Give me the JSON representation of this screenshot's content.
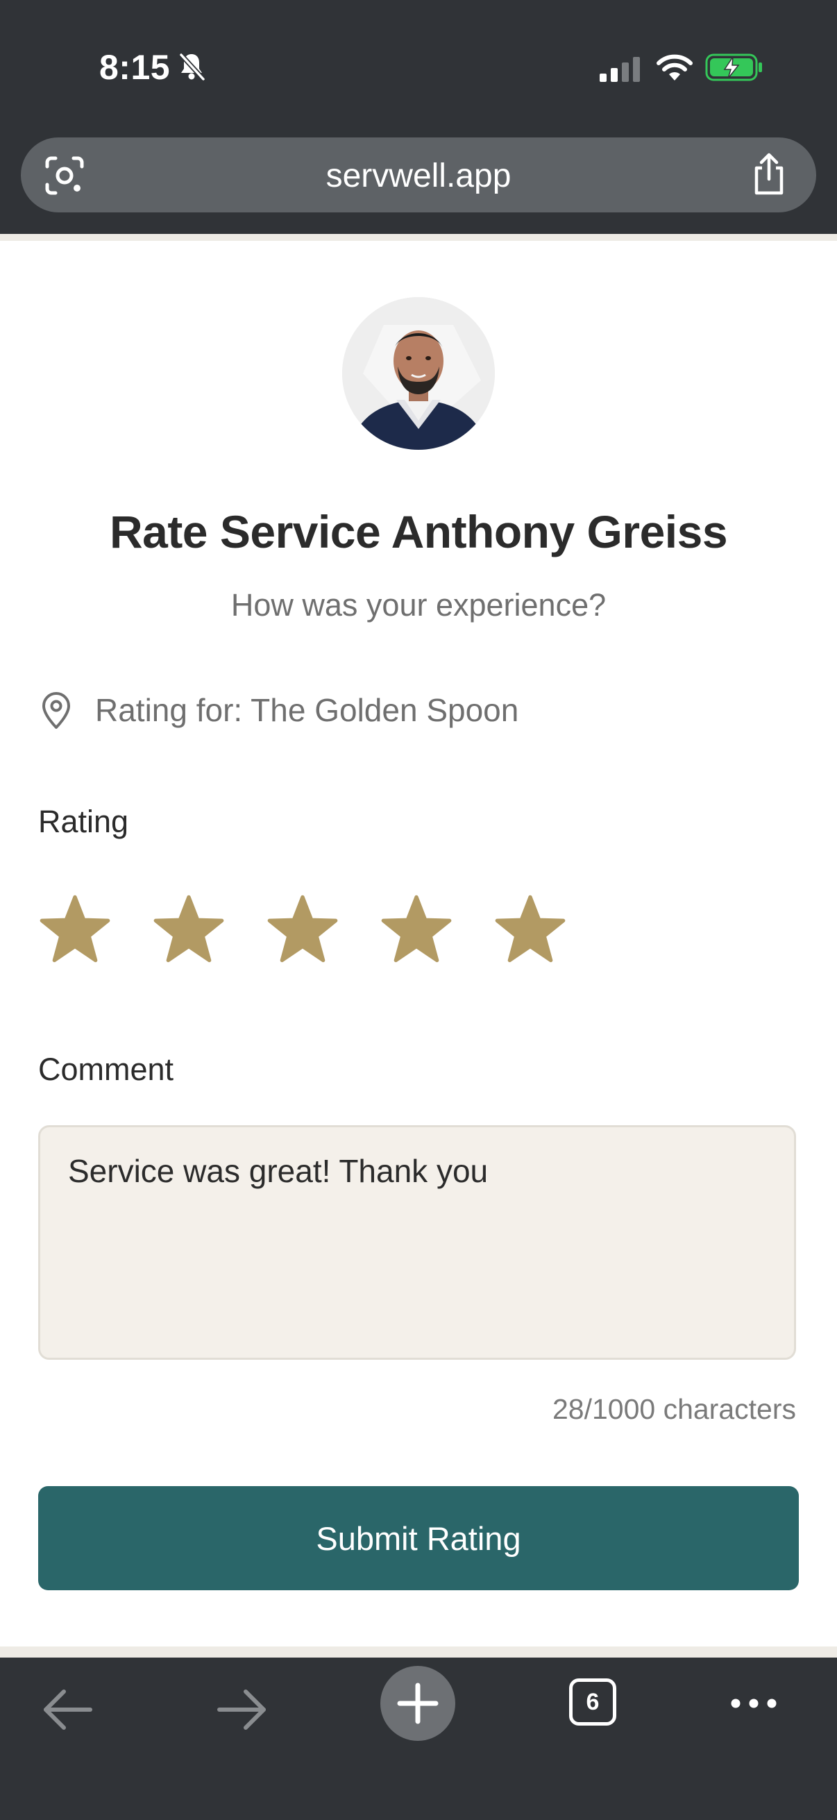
{
  "status_bar": {
    "time": "8:15",
    "icons": [
      "bell-slash-icon",
      "cellular-signal-icon",
      "wifi-icon",
      "battery-charging-icon"
    ],
    "battery_color": "#34c759"
  },
  "browser": {
    "url": "servwell.app",
    "icons": [
      "lens-icon",
      "share-icon"
    ]
  },
  "profile": {
    "title": "Rate Service Anthony Greiss",
    "subtitle": "How was your experience?"
  },
  "location": {
    "icon": "location-pin-icon",
    "text": "Rating for: The Golden Spoon"
  },
  "rating": {
    "label": "Rating",
    "value": 5,
    "max": 5,
    "star_color": "#b29a63"
  },
  "comment": {
    "label": "Comment",
    "value": "Service was great! Thank you",
    "char_count": "28/1000 characters"
  },
  "submit": {
    "label": "Submit Rating",
    "color": "#2a6669"
  },
  "toolbar": {
    "tab_count": "6",
    "icons": [
      "back-arrow-icon",
      "forward-arrow-icon",
      "plus-icon",
      "tabs-icon",
      "more-icon"
    ]
  }
}
